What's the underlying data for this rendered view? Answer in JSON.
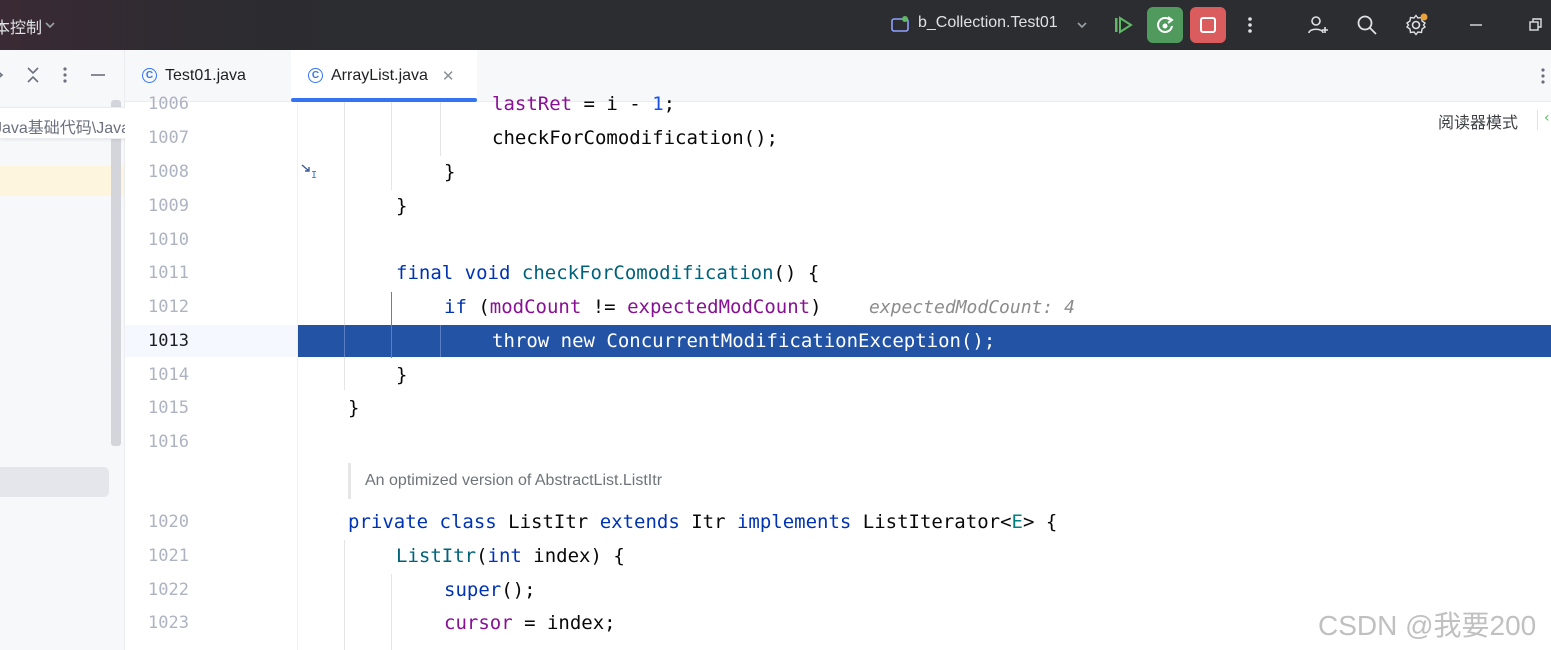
{
  "titlebar": {
    "vcs_label": "本控制",
    "run_config": "b_Collection.Test01"
  },
  "sidebar": {
    "path_label": "Java基础代码\\JavaBasics"
  },
  "tabs": [
    {
      "label": "Test01.java",
      "active": false
    },
    {
      "label": "ArrayList.java",
      "active": true
    }
  ],
  "editor": {
    "reader_mode": "阅读器模式",
    "doc_comment": "An optimized version of AbstractList.ListItr",
    "inlay_hint": "expectedModCount: 4",
    "line_numbers": [
      "1006",
      "1007",
      "1008",
      "1009",
      "1010",
      "1011",
      "1012",
      "1013",
      "1014",
      "1015",
      "1016",
      "1020",
      "1021",
      "1022",
      "1023"
    ],
    "lines": {
      "l1006_a": "lastRet",
      "l1006_b": " = ",
      "l1006_c": "i",
      "l1006_d": " - ",
      "l1006_e": "1",
      "l1006_f": ";",
      "l1007": "checkForComodification();",
      "l1008": "}",
      "l1009": "}",
      "l1011_a": "final",
      "l1011_b": " ",
      "l1011_c": "void",
      "l1011_d": " ",
      "l1011_e": "checkForComodification",
      "l1011_f": "() {",
      "l1012_a": "if",
      "l1012_b": " (",
      "l1012_c": "modCount",
      "l1012_d": " != ",
      "l1012_e": "expectedModCount",
      "l1012_f": ")",
      "l1013": "throw new ConcurrentModificationException();",
      "l1014": "}",
      "l1015": "}",
      "l1020_a": "private",
      "l1020_b": " ",
      "l1020_c": "class",
      "l1020_d": " ListItr ",
      "l1020_e": "extends",
      "l1020_f": " Itr ",
      "l1020_g": "implements",
      "l1020_h": " ListIterator<",
      "l1020_i": "E",
      "l1020_j": "> {",
      "l1021_a": "ListItr",
      "l1021_b": "(",
      "l1021_c": "int",
      "l1021_d": " index) {",
      "l1022_a": "super",
      "l1022_b": "();",
      "l1023_a": "cursor",
      "l1023_b": " = index;"
    }
  },
  "watermark": "CSDN @我要200",
  "colors": {
    "titlebar": "#2b2d30",
    "execution_line": "#2253a5",
    "keyword": "#0033b3",
    "method": "#00627a",
    "field": "#871094",
    "run_green": "#4f9a5c",
    "stop_red": "#db5c5c"
  }
}
